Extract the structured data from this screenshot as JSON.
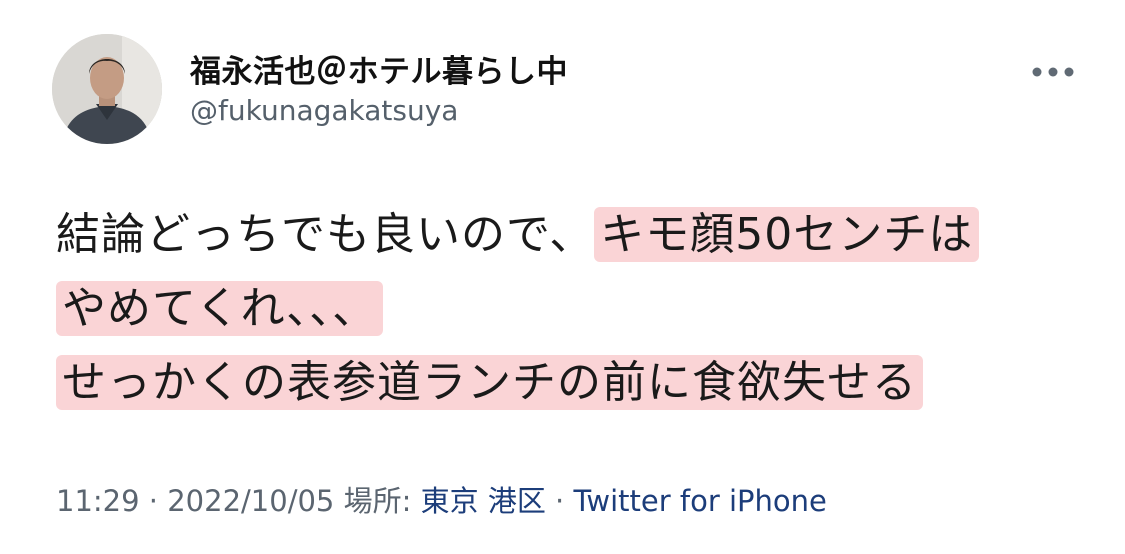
{
  "tweet": {
    "display_name": "福永活也＠ホテル暮らし中",
    "handle": "@fukunagakatsuya",
    "more_icon": "more-horizontal-icon",
    "body": {
      "line1_plain": "結論どっちでも良いので、",
      "line1_highlight": "キモ顔50センチは",
      "line2_highlight": "やめてくれ、、、",
      "line3_highlight": "せっかくの表参道ランチの前に食欲失せる"
    },
    "highlight_color": "#fad4d6",
    "meta": {
      "time": "11:29",
      "separator": " · ",
      "date": "2022/10/05",
      "location_label": "場所: ",
      "location": "東京 港区",
      "source": "Twitter for iPhone"
    },
    "colors": {
      "text": "#1a1a1a",
      "secondary": "#5b6570",
      "link": "#1c3d7a"
    }
  }
}
